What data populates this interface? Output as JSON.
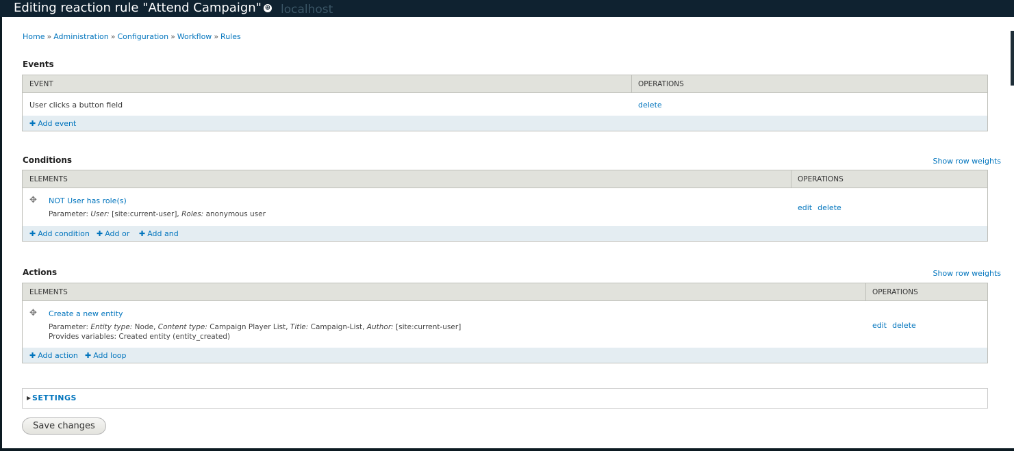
{
  "window": {
    "title": "Editing reaction rule \"Attend Campaign\"",
    "title_icon": "⊕",
    "ghost_text": "localhost"
  },
  "breadcrumb": [
    "Home",
    "Administration",
    "Configuration",
    "Workflow",
    "Rules"
  ],
  "breadcrumb_sep": "»",
  "events": {
    "title": "Events",
    "col_event": "EVENT",
    "col_operations": "OPERATIONS",
    "rows": [
      {
        "label": "User clicks a button field",
        "op_delete": "delete"
      }
    ],
    "add_event": "Add event"
  },
  "conditions": {
    "title": "Conditions",
    "show_row_weights": "Show row weights",
    "col_elements": "ELEMENTS",
    "col_operations": "OPERATIONS",
    "rows": [
      {
        "label": "NOT User has role(s)",
        "param_prefix": "Parameter:",
        "param_user_key": "User:",
        "param_user_val": "[site:current-user],",
        "param_roles_key": "Roles:",
        "param_roles_val": "anonymous user",
        "op_edit": "edit",
        "op_delete": "delete"
      }
    ],
    "add_condition": "Add condition",
    "add_or": "Add or",
    "add_and": "Add and"
  },
  "actions": {
    "title": "Actions",
    "show_row_weights": "Show row weights",
    "col_elements": "ELEMENTS",
    "col_operations": "OPERATIONS",
    "rows": [
      {
        "label": "Create a new entity",
        "param_prefix": "Parameter:",
        "entity_type_key": "Entity type:",
        "entity_type_val": "Node,",
        "content_type_key": "Content type:",
        "content_type_val": "Campaign Player List,",
        "title_key": "Title:",
        "title_val": "Campaign-List,",
        "author_key": "Author:",
        "author_val": "[site:current-user]",
        "provides": "Provides variables: Created entity (entity_created)",
        "op_edit": "edit",
        "op_delete": "delete"
      }
    ],
    "add_action": "Add action",
    "add_loop": "Add loop"
  },
  "settings": {
    "label": "SETTINGS"
  },
  "save_button": "Save changes",
  "colors": {
    "link": "#0074bd",
    "header_bg": "#e1e2dc",
    "footer_bg": "#e4edf2",
    "topbar": "#0f2230"
  }
}
